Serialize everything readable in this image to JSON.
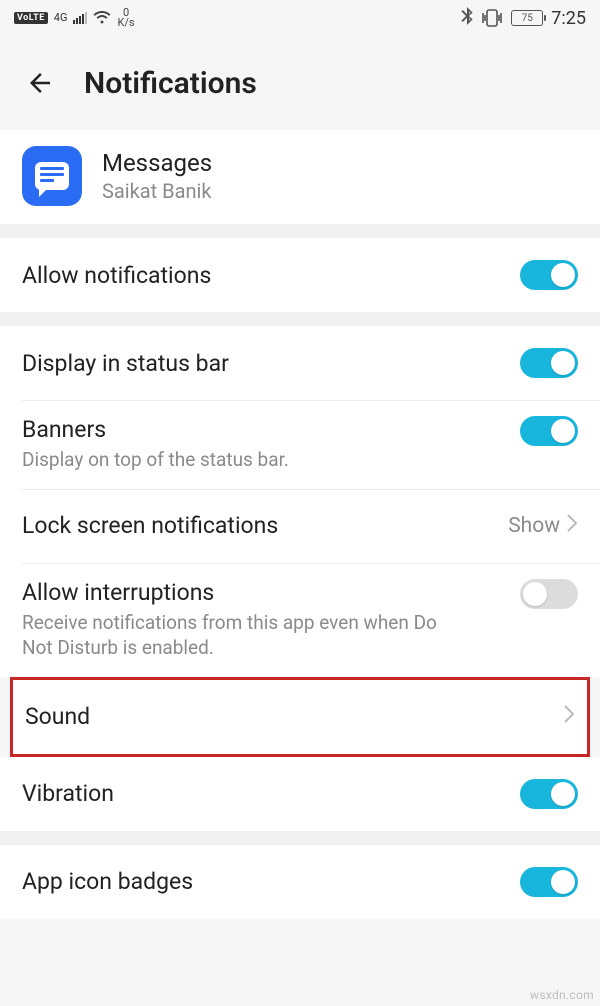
{
  "status": {
    "volte": "VoLTE",
    "net_label": "4G",
    "net_sub": "+",
    "speed_top": "0",
    "speed_bottom": "K/s",
    "battery": "75",
    "time": "7:25"
  },
  "header": {
    "title": "Notifications"
  },
  "app": {
    "name": "Messages",
    "subtitle": "Saikat Banik"
  },
  "rows": {
    "allow_notifications": {
      "label": "Allow notifications"
    },
    "display_status_bar": {
      "label": "Display in status bar"
    },
    "banners": {
      "label": "Banners",
      "sub": "Display on top of the status bar."
    },
    "lock_screen": {
      "label": "Lock screen notifications",
      "value": "Show"
    },
    "allow_interruptions": {
      "label": "Allow interruptions",
      "sub": "Receive notifications from this app even when Do Not Disturb is enabled."
    },
    "sound": {
      "label": "Sound"
    },
    "vibration": {
      "label": "Vibration"
    },
    "app_icon_badges": {
      "label": "App icon badges"
    }
  },
  "watermark": "wsxdn.com"
}
